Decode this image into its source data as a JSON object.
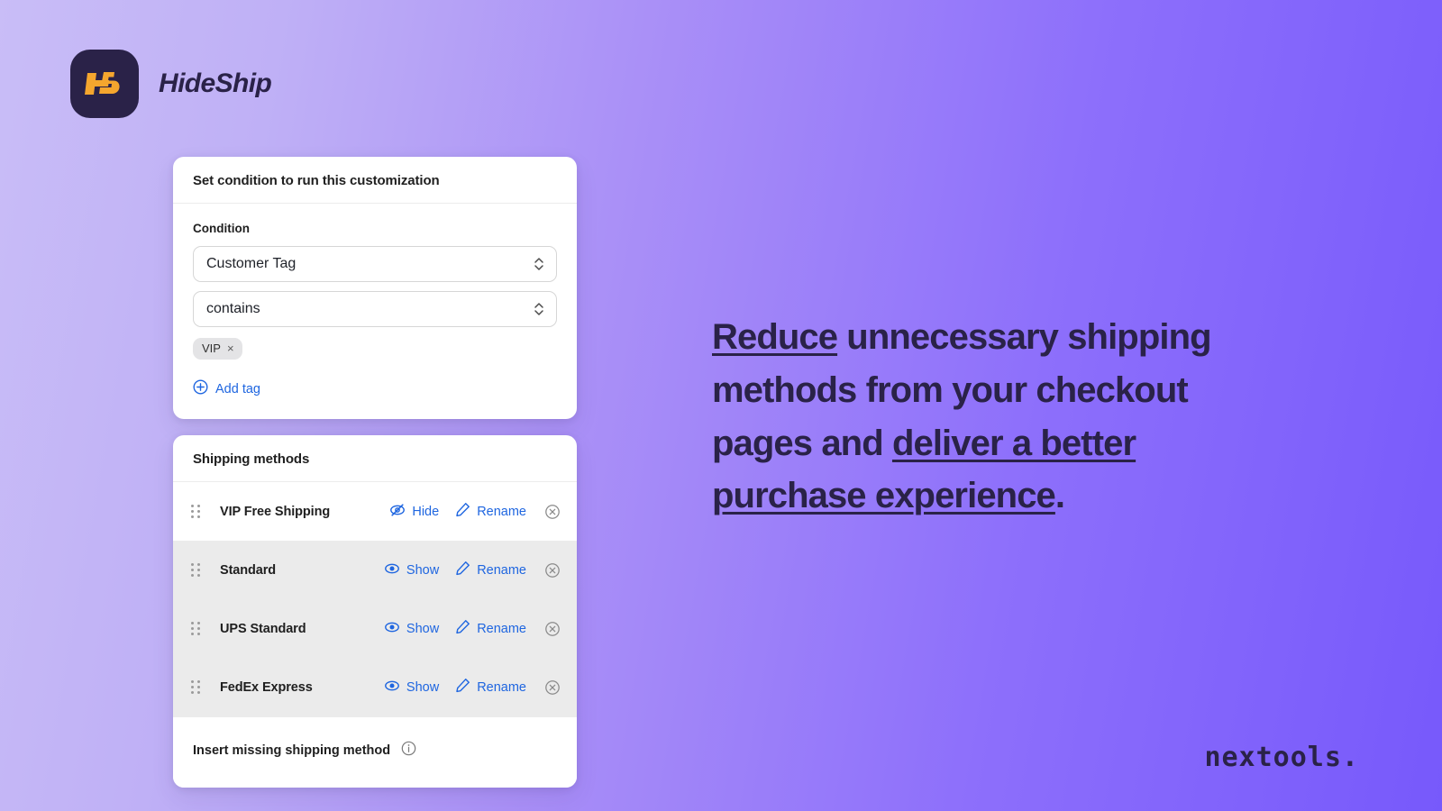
{
  "brand": {
    "name": "HideShip",
    "mark_alt": "HS",
    "mark_bg": "#2a2248",
    "mark_fg": "#f5a62e"
  },
  "condition_card": {
    "title": "Set condition to run this customization",
    "field_label": "Condition",
    "subject_value": "Customer Tag",
    "operator_value": "contains",
    "tags": [
      {
        "label": "VIP",
        "remove": "×"
      }
    ],
    "add_tag_label": "Add tag"
  },
  "shipping_card": {
    "title": "Shipping methods",
    "rows": [
      {
        "name": "VIP Free Shipping",
        "toggle_label": "Hide",
        "toggle_icon": "eye-off-icon",
        "rename_label": "Rename",
        "shaded": false
      },
      {
        "name": "Standard",
        "toggle_label": "Show",
        "toggle_icon": "eye-icon",
        "rename_label": "Rename",
        "shaded": true
      },
      {
        "name": "UPS Standard",
        "toggle_label": "Show",
        "toggle_icon": "eye-icon",
        "rename_label": "Rename",
        "shaded": true
      },
      {
        "name": "FedEx Express",
        "toggle_label": "Show",
        "toggle_icon": "eye-icon",
        "rename_label": "Rename",
        "shaded": true
      }
    ],
    "insert_label": "Insert missing shipping method"
  },
  "headline": {
    "part1": "Reduce",
    "part2": " unnecessary shipping methods from your checkout pages and ",
    "part3": "deliver a better purchase experience",
    "part4": "."
  },
  "footer": {
    "logo": "nextools."
  },
  "colors": {
    "accent_link": "#1f66e0",
    "brand_dark": "#2a2248",
    "brand_amber": "#f5a62e",
    "gradient_start": "#c9bdf7",
    "gradient_end": "#7759fb",
    "row_shaded": "#ebebeb"
  }
}
